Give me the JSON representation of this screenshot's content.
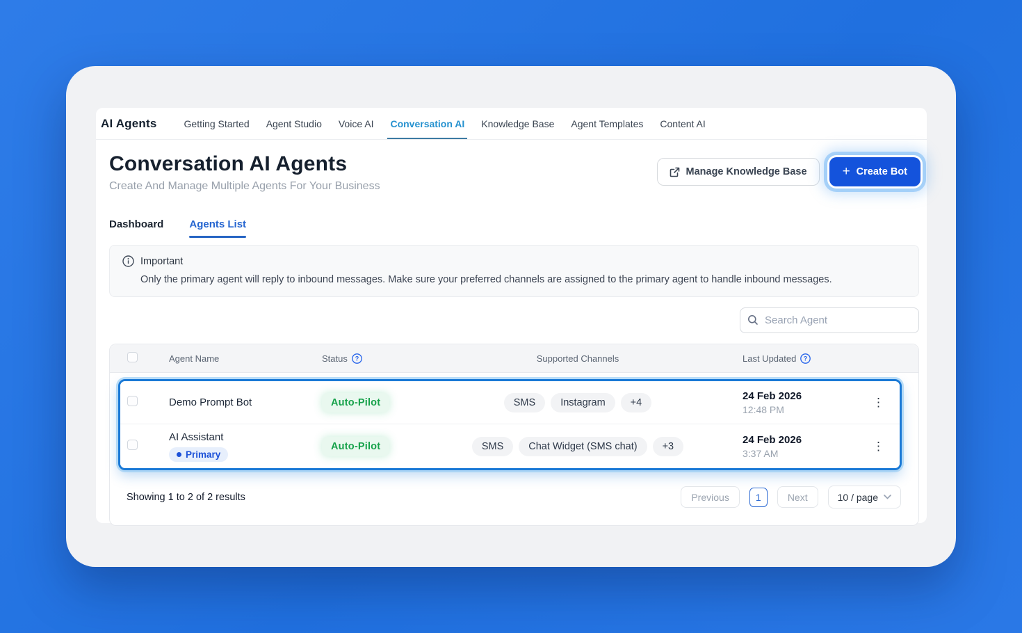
{
  "nav": {
    "brand": "AI Agents",
    "items": [
      {
        "label": "Getting Started",
        "active": false
      },
      {
        "label": "Agent Studio",
        "active": false
      },
      {
        "label": "Voice AI",
        "active": false
      },
      {
        "label": "Conversation AI",
        "active": true
      },
      {
        "label": "Knowledge Base",
        "active": false
      },
      {
        "label": "Agent Templates",
        "active": false
      },
      {
        "label": "Content AI",
        "active": false
      }
    ]
  },
  "header": {
    "title": "Conversation AI Agents",
    "subtitle": "Create And Manage Multiple Agents For Your Business",
    "manage_kb_label": "Manage Knowledge Base",
    "create_bot_label": "Create Bot"
  },
  "tabs": [
    {
      "label": "Dashboard",
      "active": false
    },
    {
      "label": "Agents List",
      "active": true
    }
  ],
  "notice": {
    "title": "Important",
    "body": "Only the primary agent will reply to inbound messages. Make sure your preferred channels are assigned to the primary agent to handle inbound messages."
  },
  "search": {
    "placeholder": "Search Agent"
  },
  "table": {
    "columns": [
      "Agent Name",
      "Status",
      "Supported Channels",
      "Last Updated"
    ],
    "rows": [
      {
        "name": "Demo Prompt Bot",
        "status": "Auto-Pilot",
        "channels": [
          "SMS",
          "Instagram"
        ],
        "more": "+4",
        "date": "24 Feb 2026",
        "time": "12:48 PM"
      },
      {
        "name": "AI Assistant",
        "primary_label": "Primary",
        "status": "Auto-Pilot",
        "channels": [
          "SMS",
          "Chat Widget (SMS chat)"
        ],
        "more": "+3",
        "date": "24 Feb 2026",
        "time": "3:37 AM"
      }
    ]
  },
  "footer": {
    "summary": "Showing 1 to 2 of 2 results",
    "previous_label": "Previous",
    "page": "1",
    "next_label": "Next",
    "page_size": "10 / page"
  },
  "icons": {
    "plus": "+",
    "kebab": "⋮",
    "chevron_down": "⌄"
  },
  "colors": {
    "background_blue": "#2173e2",
    "primary_button_blue": "#1453dc",
    "active_nav_blue": "#2591cf",
    "active_tab_blue": "#2565d0",
    "selection_border_blue": "#1a79d6",
    "status_green": "#17a24b",
    "status_green_bg": "#e9f8ef",
    "primary_badge_blue": "#1d52d8",
    "primary_badge_bg": "#e7effc"
  }
}
